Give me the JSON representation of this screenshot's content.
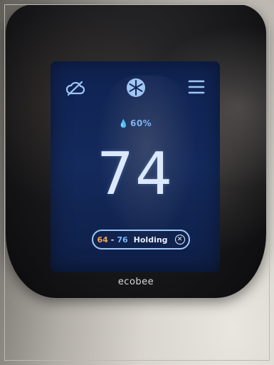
{
  "thermostat": {
    "humidity": "60%",
    "temperature": "74",
    "hold": {
      "heat_setpoint": "64",
      "separator": "-",
      "cool_setpoint": "76",
      "label": "Holding"
    },
    "brand": "ecobee",
    "icons": [
      "weather-cloud-icon",
      "snowflake-icon",
      "menu-icon",
      "humidity-drop-icon",
      "cancel-icon"
    ]
  },
  "colors": {
    "screen": "#142a5c",
    "accent_blue": "#9fc6f5",
    "heat_orange": "#f5a64a",
    "cool_blue": "#7ab8ff"
  }
}
